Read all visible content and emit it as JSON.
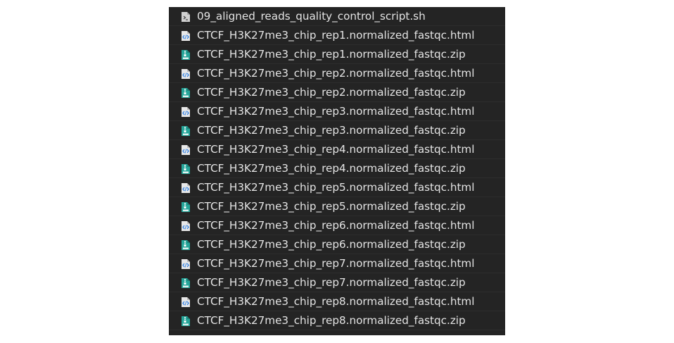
{
  "files": [
    {
      "name": "09_aligned_reads_quality_control_script.sh",
      "icon": "script-file-icon"
    },
    {
      "name": "CTCF_H3K27me3_chip_rep1.normalized_fastqc.html",
      "icon": "html-file-icon"
    },
    {
      "name": "CTCF_H3K27me3_chip_rep1.normalized_fastqc.zip",
      "icon": "zip-file-icon"
    },
    {
      "name": "CTCF_H3K27me3_chip_rep2.normalized_fastqc.html",
      "icon": "html-file-icon"
    },
    {
      "name": "CTCF_H3K27me3_chip_rep2.normalized_fastqc.zip",
      "icon": "zip-file-icon"
    },
    {
      "name": "CTCF_H3K27me3_chip_rep3.normalized_fastqc.html",
      "icon": "html-file-icon"
    },
    {
      "name": "CTCF_H3K27me3_chip_rep3.normalized_fastqc.zip",
      "icon": "zip-file-icon"
    },
    {
      "name": "CTCF_H3K27me3_chip_rep4.normalized_fastqc.html",
      "icon": "html-file-icon"
    },
    {
      "name": "CTCF_H3K27me3_chip_rep4.normalized_fastqc.zip",
      "icon": "zip-file-icon"
    },
    {
      "name": "CTCF_H3K27me3_chip_rep5.normalized_fastqc.html",
      "icon": "html-file-icon"
    },
    {
      "name": "CTCF_H3K27me3_chip_rep5.normalized_fastqc.zip",
      "icon": "zip-file-icon"
    },
    {
      "name": "CTCF_H3K27me3_chip_rep6.normalized_fastqc.html",
      "icon": "html-file-icon"
    },
    {
      "name": "CTCF_H3K27me3_chip_rep6.normalized_fastqc.zip",
      "icon": "zip-file-icon"
    },
    {
      "name": "CTCF_H3K27me3_chip_rep7.normalized_fastqc.html",
      "icon": "html-file-icon"
    },
    {
      "name": "CTCF_H3K27me3_chip_rep7.normalized_fastqc.zip",
      "icon": "zip-file-icon"
    },
    {
      "name": "CTCF_H3K27me3_chip_rep8.normalized_fastqc.html",
      "icon": "html-file-icon"
    },
    {
      "name": "CTCF_H3K27me3_chip_rep8.normalized_fastqc.zip",
      "icon": "zip-file-icon"
    }
  ],
  "colors": {
    "panel_background": "#242424",
    "file_name_text": "#e4e4e4",
    "zip_icon": "#26a69a",
    "html_icon": "#e8e8e8",
    "html_icon_symbol": "#3584e4",
    "script_icon": "#d0d0d0"
  }
}
